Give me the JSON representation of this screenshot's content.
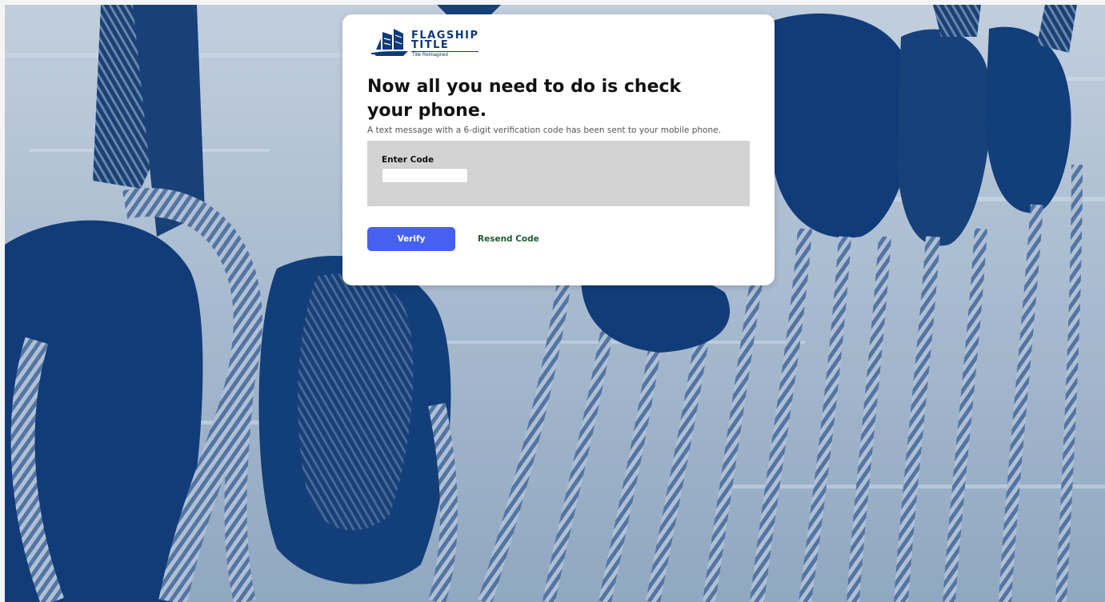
{
  "brand": {
    "name_line1": "FLAGSHIP",
    "name_line2": "TITLE",
    "tagline": "Title Reimagined",
    "color": "#0e3a78"
  },
  "heading": "Now all you need to do is check your phone.",
  "subtext": "A text message with a 6-digit verification code has been sent to your mobile phone.",
  "form": {
    "code_label": "Enter Code",
    "code_value": "",
    "code_placeholder": ""
  },
  "actions": {
    "verify_label": "Verify",
    "resend_label": "Resend Code"
  },
  "colors": {
    "verify_button": "#4660f0",
    "resend_link": "#1f5a2e",
    "code_panel": "#d3d3d3",
    "background_tint": "#0e3a78"
  },
  "icons": {
    "logo": "ship-logo-icon"
  }
}
